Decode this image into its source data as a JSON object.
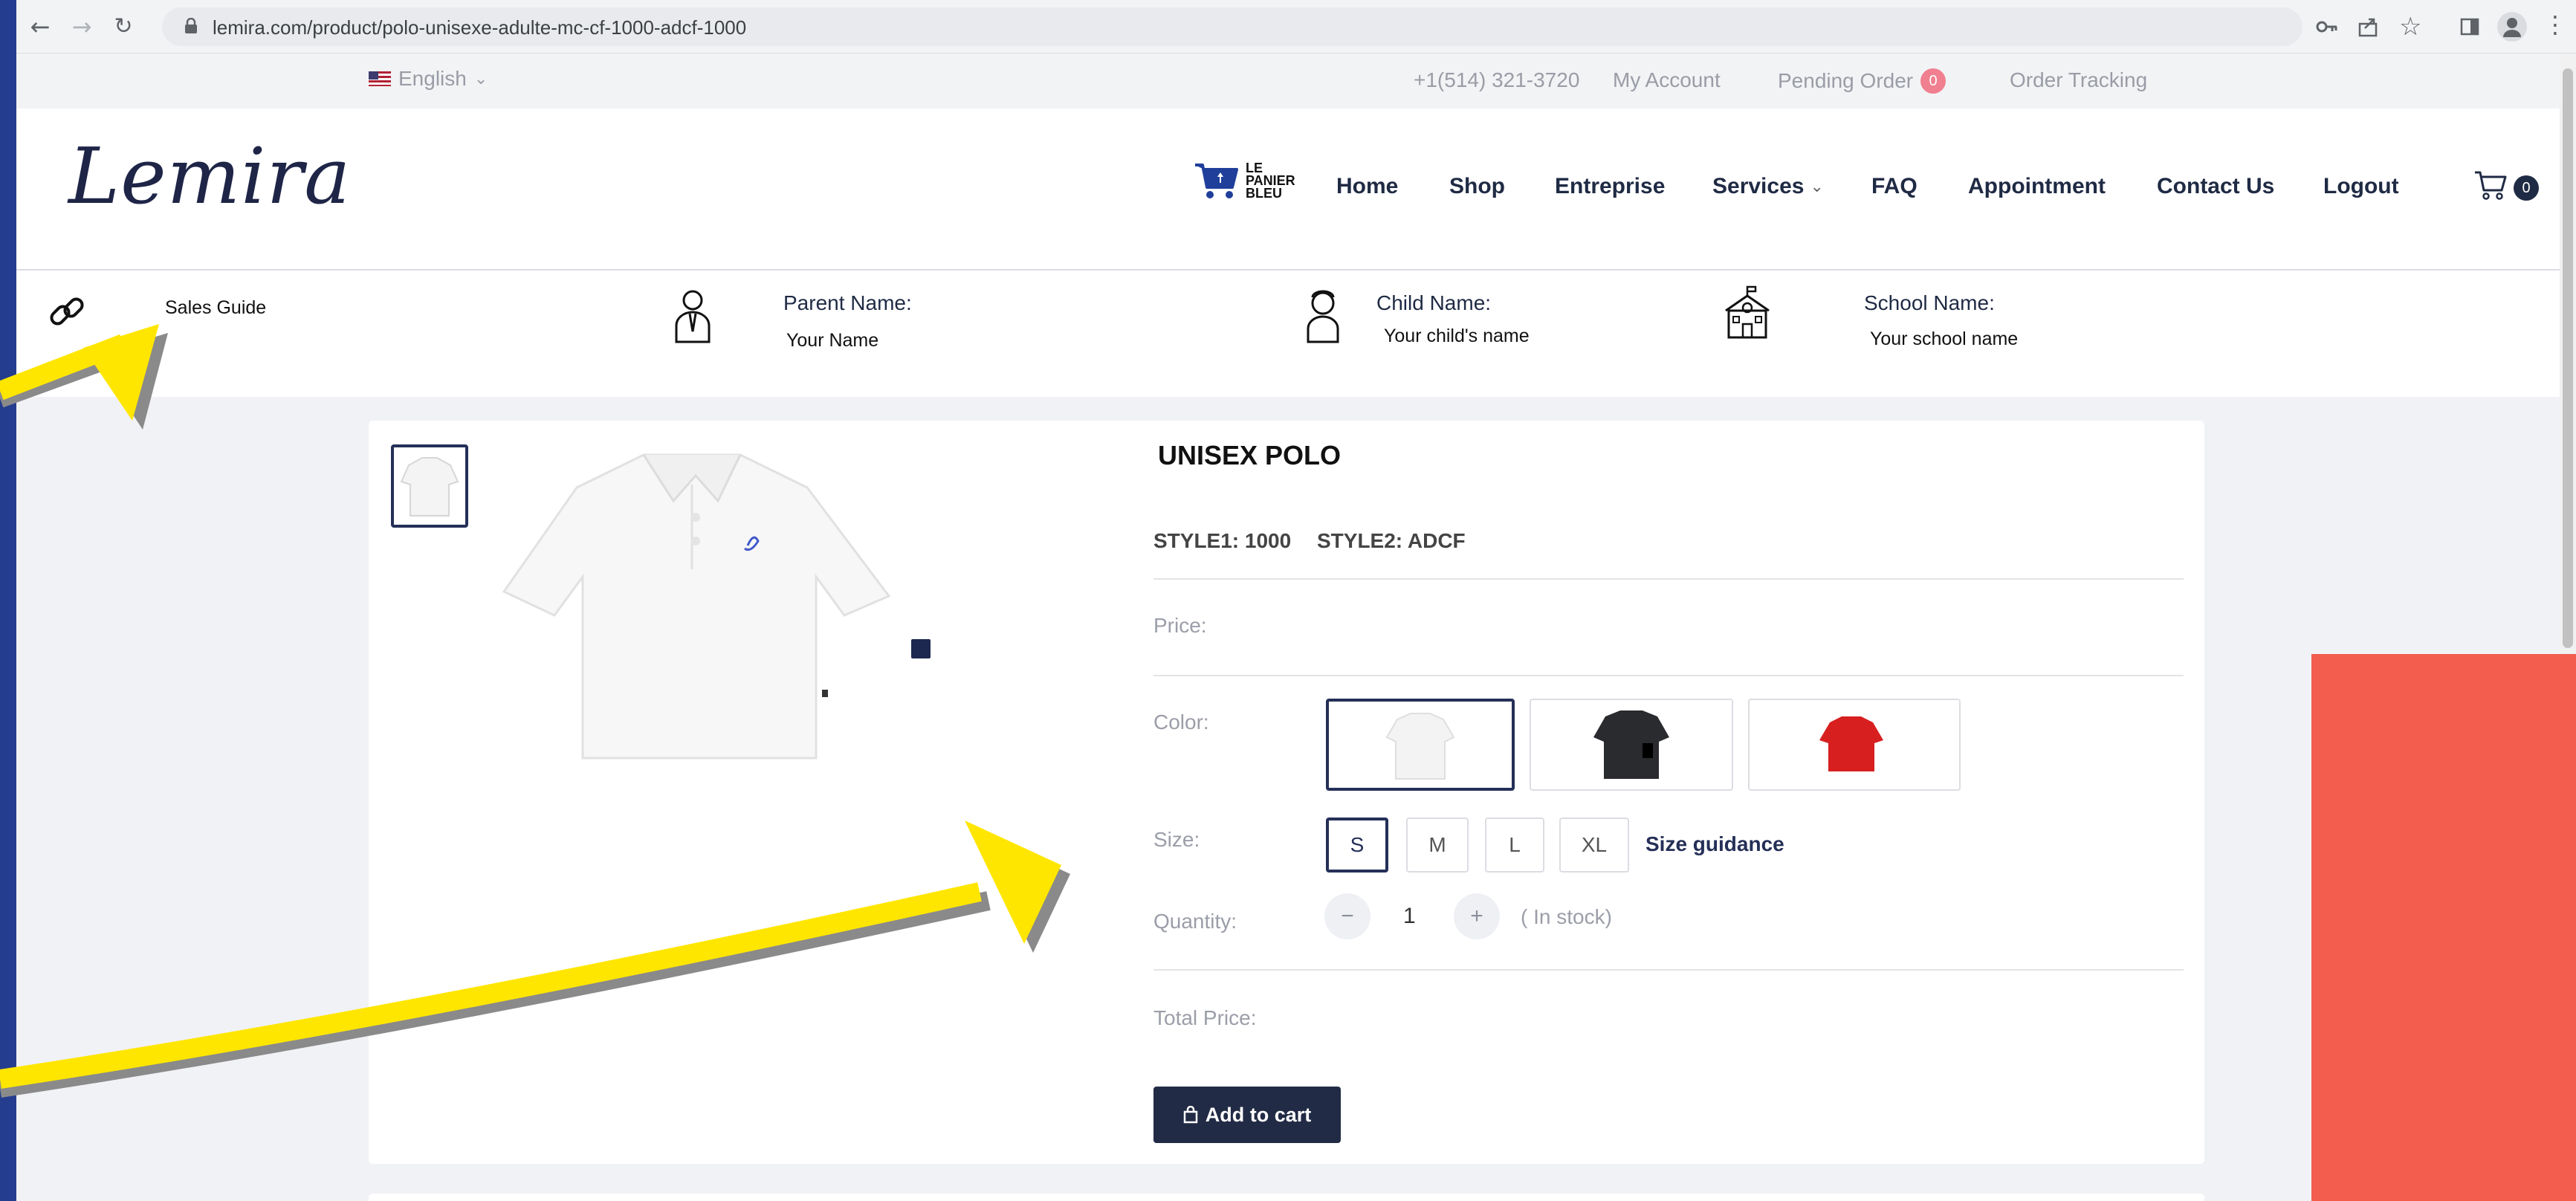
{
  "browser": {
    "url": "lemira.com/product/polo-unisexe-adulte-mc-cf-1000-adcf-1000"
  },
  "topbar": {
    "language": "English",
    "phone": "+1(514) 321-3720",
    "my_account": "My Account",
    "pending_order": "Pending Order",
    "pending_count": "0",
    "order_tracking": "Order Tracking"
  },
  "header": {
    "logo": "Lemira",
    "partner_logo_lines": [
      "LE",
      "PANIER",
      "BLEU"
    ],
    "nav": [
      "Home",
      "Shop",
      "Entreprise",
      "Services",
      "FAQ",
      "Appointment",
      "Contact Us",
      "Logout"
    ],
    "cart_count": "0"
  },
  "infobar": {
    "sales_guide": "Sales Guide",
    "parent_label": "Parent Name:",
    "parent_value": "Your Name",
    "child_label": "Child Name:",
    "child_value": "Your child's name",
    "school_label": "School Name:",
    "school_value": "Your school name"
  },
  "product": {
    "title": "UNISEX POLO",
    "style1": "STYLE1: 1000",
    "style2": "STYLE2: ADCF",
    "price_label": "Price:",
    "color_label": "Color:",
    "colors": [
      "white",
      "black",
      "red"
    ],
    "size_label": "Size:",
    "sizes": [
      "S",
      "M",
      "L",
      "XL"
    ],
    "selected_size": "S",
    "size_guidance": "Size guidance",
    "quantity_label": "Quantity:",
    "quantity": "1",
    "stock": "( In stock)",
    "total_label": "Total Price:",
    "add_to_cart": "Add to cart"
  },
  "colors": {
    "page_bg": "#253d8e",
    "navy": "#222b45",
    "badge": "#f07f8f",
    "arrow": "#ffe600",
    "panel": "#f25d4e"
  }
}
